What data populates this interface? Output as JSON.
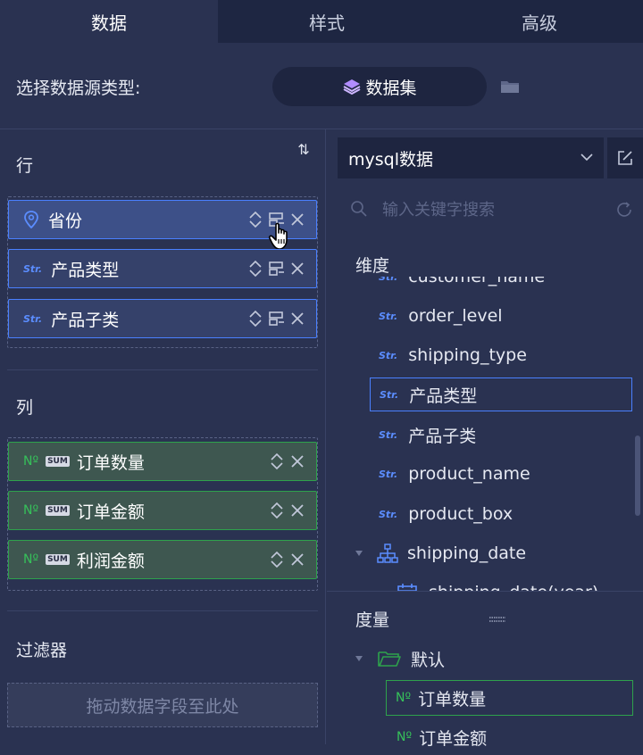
{
  "tabs": [
    {
      "label": "数据",
      "active": true
    },
    {
      "label": "样式",
      "active": false
    },
    {
      "label": "高级",
      "active": false
    }
  ],
  "source": {
    "label": "选择数据源类型:",
    "type_label": "数据集",
    "type_icon": "layers-icon",
    "folder_icon": "folder-icon"
  },
  "rows_section": {
    "title": "行",
    "sort_icon": "⇅",
    "fields": [
      {
        "tag": "",
        "icon": "location-pin-icon",
        "label": "省份"
      },
      {
        "tag": "Str.",
        "label": "产品类型"
      },
      {
        "tag": "Str.",
        "label": "产品子类"
      }
    ]
  },
  "cols_section": {
    "title": "列",
    "fields": [
      {
        "tag": "Nº",
        "agg": "SUM",
        "label": "订单数量"
      },
      {
        "tag": "Nº",
        "agg": "SUM",
        "label": "订单金额"
      },
      {
        "tag": "Nº",
        "agg": "SUM",
        "label": "利润金额"
      }
    ]
  },
  "filters_section": {
    "title": "过滤器",
    "drop_placeholder": "拖动数据字段至此处"
  },
  "dataset": {
    "selected": "mysql数据",
    "search_placeholder": "输入关键字搜索"
  },
  "dimensions": {
    "title": "维度",
    "partial_top": "customer_name",
    "items": [
      {
        "tag": "Str.",
        "label": "order_level"
      },
      {
        "tag": "Str.",
        "label": "shipping_type"
      },
      {
        "tag": "Str.",
        "label": "产品类型",
        "selected": true
      },
      {
        "tag": "Str.",
        "label": "产品子类"
      },
      {
        "tag": "Str.",
        "label": "product_name"
      },
      {
        "tag": "Str.",
        "label": "product_box"
      },
      {
        "tag": "hierarchy",
        "label": "shipping_date",
        "expandable": true
      },
      {
        "tag": "calendar",
        "label": "shipping_date(year)"
      }
    ]
  },
  "measures": {
    "title": "度量",
    "folder_label": "默认",
    "items": [
      {
        "tag": "Nº",
        "label": "订单数量",
        "selected": true
      },
      {
        "tag": "Nº",
        "label": "订单金额"
      }
    ]
  },
  "colors": {
    "accent_blue": "#4a80ff",
    "accent_green": "#2ea24c",
    "background": "#2a3251"
  }
}
